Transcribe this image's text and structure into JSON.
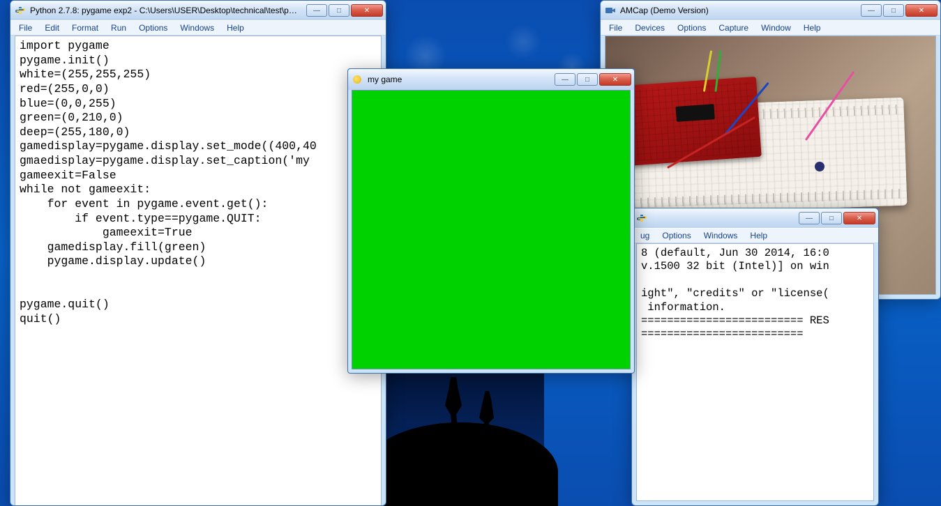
{
  "idle": {
    "title": "Python 2.7.8: pygame exp2 - C:\\Users\\USER\\Desktop\\technical\\test\\pygam...",
    "menu": [
      "File",
      "Edit",
      "Format",
      "Run",
      "Options",
      "Windows",
      "Help"
    ],
    "code": "import pygame\npygame.init()\nwhite=(255,255,255)\nred=(255,0,0)\nblue=(0,0,255)\ngreen=(0,210,0)\ndeep=(255,180,0)\ngamedisplay=pygame.display.set_mode((400,40\ngmaedisplay=pygame.display.set_caption('my\ngameexit=False\nwhile not gameexit:\n    for event in pygame.event.get():\n        if event.type==pygame.QUIT:\n            gameexit=True\n    gamedisplay.fill(green)\n    pygame.display.update()\n\n\npygame.quit()\nquit()"
  },
  "amcap": {
    "title": "AMCap (Demo Version)",
    "menu": [
      "File",
      "Devices",
      "Options",
      "Capture",
      "Window",
      "Help"
    ]
  },
  "pyshell": {
    "menu_partial": [
      "ug",
      "Options",
      "Windows",
      "Help"
    ],
    "output": "8 (default, Jun 30 2014, 16:0\nv.1500 32 bit (Intel)] on win\n\night\", \"credits\" or \"license(\n information.\n========================= RES\n========================="
  },
  "pygame": {
    "title": "my game",
    "fill_color": "#00d200"
  },
  "win_controls": {
    "min_glyph": "—",
    "max_glyph": "□",
    "close_glyph": "✕"
  }
}
